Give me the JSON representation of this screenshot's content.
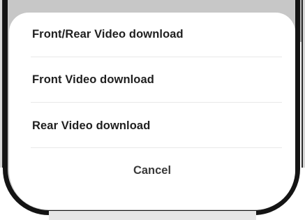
{
  "action_sheet": {
    "options": [
      {
        "label": "Front/Rear Video download"
      },
      {
        "label": "Front Video download"
      },
      {
        "label": "Rear Video download"
      }
    ],
    "cancel_label": "Cancel"
  }
}
